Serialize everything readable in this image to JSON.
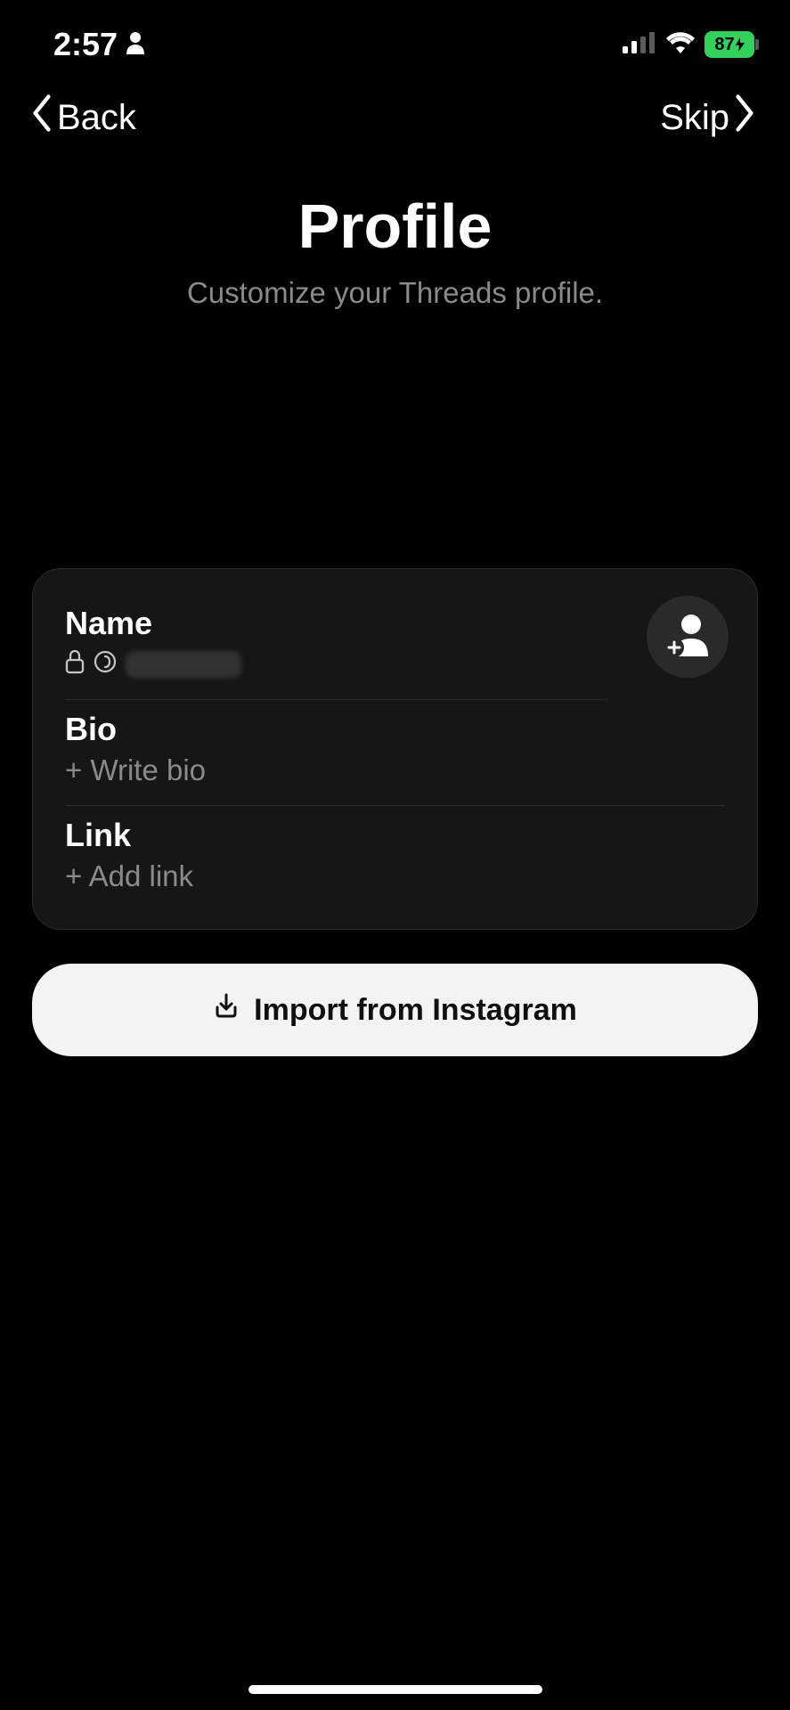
{
  "statusBar": {
    "time": "2:57",
    "batteryText": "87"
  },
  "nav": {
    "backLabel": "Back",
    "skipLabel": "Skip"
  },
  "heading": {
    "title": "Profile",
    "subtitle": "Customize your Threads profile."
  },
  "profileCard": {
    "name": {
      "label": "Name",
      "value": ""
    },
    "bio": {
      "label": "Bio",
      "placeholder": "+ Write bio"
    },
    "link": {
      "label": "Link",
      "placeholder": "+ Add link"
    }
  },
  "importBtn": {
    "label": "Import from Instagram"
  }
}
